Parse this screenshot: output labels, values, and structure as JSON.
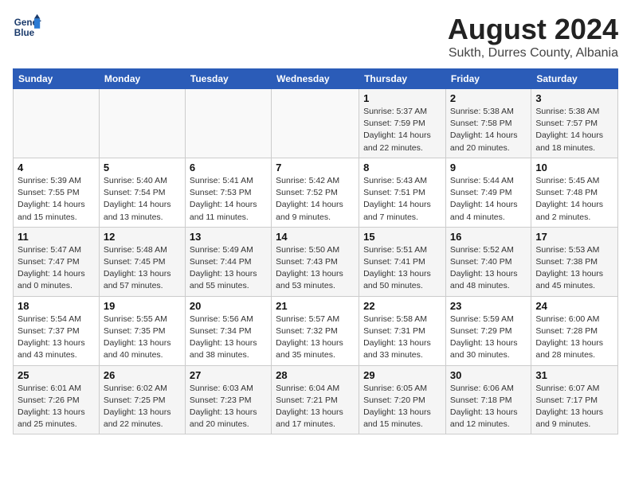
{
  "header": {
    "logo_line1": "General",
    "logo_line2": "Blue",
    "month_year": "August 2024",
    "location": "Sukth, Durres County, Albania"
  },
  "weekdays": [
    "Sunday",
    "Monday",
    "Tuesday",
    "Wednesday",
    "Thursday",
    "Friday",
    "Saturday"
  ],
  "weeks": [
    [
      {
        "day": "",
        "info": ""
      },
      {
        "day": "",
        "info": ""
      },
      {
        "day": "",
        "info": ""
      },
      {
        "day": "",
        "info": ""
      },
      {
        "day": "1",
        "info": "Sunrise: 5:37 AM\nSunset: 7:59 PM\nDaylight: 14 hours\nand 22 minutes."
      },
      {
        "day": "2",
        "info": "Sunrise: 5:38 AM\nSunset: 7:58 PM\nDaylight: 14 hours\nand 20 minutes."
      },
      {
        "day": "3",
        "info": "Sunrise: 5:38 AM\nSunset: 7:57 PM\nDaylight: 14 hours\nand 18 minutes."
      }
    ],
    [
      {
        "day": "4",
        "info": "Sunrise: 5:39 AM\nSunset: 7:55 PM\nDaylight: 14 hours\nand 15 minutes."
      },
      {
        "day": "5",
        "info": "Sunrise: 5:40 AM\nSunset: 7:54 PM\nDaylight: 14 hours\nand 13 minutes."
      },
      {
        "day": "6",
        "info": "Sunrise: 5:41 AM\nSunset: 7:53 PM\nDaylight: 14 hours\nand 11 minutes."
      },
      {
        "day": "7",
        "info": "Sunrise: 5:42 AM\nSunset: 7:52 PM\nDaylight: 14 hours\nand 9 minutes."
      },
      {
        "day": "8",
        "info": "Sunrise: 5:43 AM\nSunset: 7:51 PM\nDaylight: 14 hours\nand 7 minutes."
      },
      {
        "day": "9",
        "info": "Sunrise: 5:44 AM\nSunset: 7:49 PM\nDaylight: 14 hours\nand 4 minutes."
      },
      {
        "day": "10",
        "info": "Sunrise: 5:45 AM\nSunset: 7:48 PM\nDaylight: 14 hours\nand 2 minutes."
      }
    ],
    [
      {
        "day": "11",
        "info": "Sunrise: 5:47 AM\nSunset: 7:47 PM\nDaylight: 14 hours\nand 0 minutes."
      },
      {
        "day": "12",
        "info": "Sunrise: 5:48 AM\nSunset: 7:45 PM\nDaylight: 13 hours\nand 57 minutes."
      },
      {
        "day": "13",
        "info": "Sunrise: 5:49 AM\nSunset: 7:44 PM\nDaylight: 13 hours\nand 55 minutes."
      },
      {
        "day": "14",
        "info": "Sunrise: 5:50 AM\nSunset: 7:43 PM\nDaylight: 13 hours\nand 53 minutes."
      },
      {
        "day": "15",
        "info": "Sunrise: 5:51 AM\nSunset: 7:41 PM\nDaylight: 13 hours\nand 50 minutes."
      },
      {
        "day": "16",
        "info": "Sunrise: 5:52 AM\nSunset: 7:40 PM\nDaylight: 13 hours\nand 48 minutes."
      },
      {
        "day": "17",
        "info": "Sunrise: 5:53 AM\nSunset: 7:38 PM\nDaylight: 13 hours\nand 45 minutes."
      }
    ],
    [
      {
        "day": "18",
        "info": "Sunrise: 5:54 AM\nSunset: 7:37 PM\nDaylight: 13 hours\nand 43 minutes."
      },
      {
        "day": "19",
        "info": "Sunrise: 5:55 AM\nSunset: 7:35 PM\nDaylight: 13 hours\nand 40 minutes."
      },
      {
        "day": "20",
        "info": "Sunrise: 5:56 AM\nSunset: 7:34 PM\nDaylight: 13 hours\nand 38 minutes."
      },
      {
        "day": "21",
        "info": "Sunrise: 5:57 AM\nSunset: 7:32 PM\nDaylight: 13 hours\nand 35 minutes."
      },
      {
        "day": "22",
        "info": "Sunrise: 5:58 AM\nSunset: 7:31 PM\nDaylight: 13 hours\nand 33 minutes."
      },
      {
        "day": "23",
        "info": "Sunrise: 5:59 AM\nSunset: 7:29 PM\nDaylight: 13 hours\nand 30 minutes."
      },
      {
        "day": "24",
        "info": "Sunrise: 6:00 AM\nSunset: 7:28 PM\nDaylight: 13 hours\nand 28 minutes."
      }
    ],
    [
      {
        "day": "25",
        "info": "Sunrise: 6:01 AM\nSunset: 7:26 PM\nDaylight: 13 hours\nand 25 minutes."
      },
      {
        "day": "26",
        "info": "Sunrise: 6:02 AM\nSunset: 7:25 PM\nDaylight: 13 hours\nand 22 minutes."
      },
      {
        "day": "27",
        "info": "Sunrise: 6:03 AM\nSunset: 7:23 PM\nDaylight: 13 hours\nand 20 minutes."
      },
      {
        "day": "28",
        "info": "Sunrise: 6:04 AM\nSunset: 7:21 PM\nDaylight: 13 hours\nand 17 minutes."
      },
      {
        "day": "29",
        "info": "Sunrise: 6:05 AM\nSunset: 7:20 PM\nDaylight: 13 hours\nand 15 minutes."
      },
      {
        "day": "30",
        "info": "Sunrise: 6:06 AM\nSunset: 7:18 PM\nDaylight: 13 hours\nand 12 minutes."
      },
      {
        "day": "31",
        "info": "Sunrise: 6:07 AM\nSunset: 7:17 PM\nDaylight: 13 hours\nand 9 minutes."
      }
    ]
  ]
}
